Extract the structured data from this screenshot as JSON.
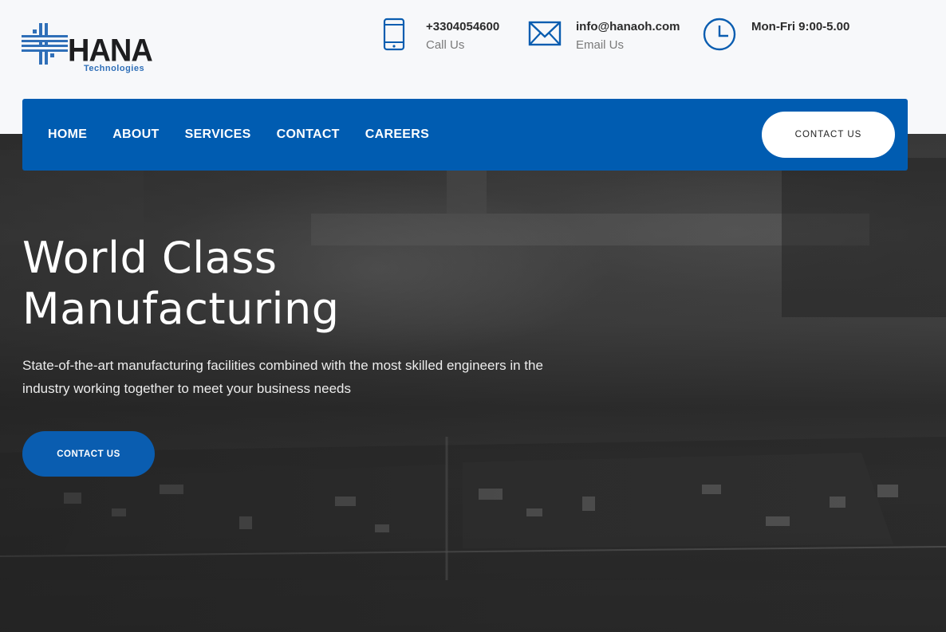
{
  "brand": {
    "name": "HANA",
    "tagline": "Technologies",
    "primary_color": "#005cb1",
    "secondary_color": "#2f6fb8"
  },
  "contact_bar": {
    "phone": {
      "value": "+3304054600",
      "label": "Call Us",
      "icon": "mobile-phone-icon"
    },
    "email": {
      "value": "info@hanaoh.com",
      "label": "Email Us",
      "icon": "envelope-icon"
    },
    "hours": {
      "value": "Mon-Fri 9:00-5.00",
      "icon": "clock-icon"
    }
  },
  "nav": {
    "items": [
      {
        "label": "HOME"
      },
      {
        "label": "ABOUT"
      },
      {
        "label": "SERVICES"
      },
      {
        "label": "CONTACT"
      },
      {
        "label": "CAREERS"
      }
    ],
    "cta_label": "CONTACT US"
  },
  "hero": {
    "title_line1": "World Class",
    "title_line2": "Manufacturing",
    "description": "State-of-the-art manufacturing facilities combined with the most skilled engineers in the industry working together to meet your business needs",
    "cta_label": "CONTACT US"
  }
}
